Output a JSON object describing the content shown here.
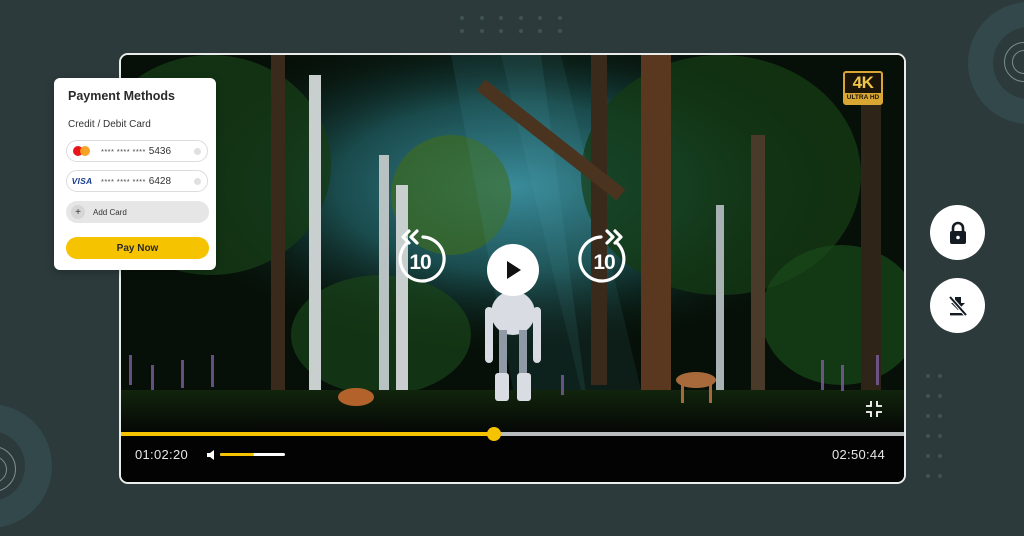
{
  "player": {
    "quality_badge": {
      "main": "4K",
      "sub": "ULTRA HD"
    },
    "skip_back_seconds": "10",
    "skip_forward_seconds": "10",
    "current_time": "01:02:20",
    "total_time": "02:50:44",
    "progress": 0.476,
    "volume": 0.52,
    "icons": {
      "play": "play-icon",
      "skip_back": "rewind-10-icon",
      "skip_forward": "forward-10-icon",
      "volume": "volume-icon",
      "fullscreen": "fullscreen-exit-icon"
    }
  },
  "payment": {
    "title": "Payment Methods",
    "subtitle": "Credit / Debit Card",
    "cards": [
      {
        "brand": "mastercard",
        "mask": "**** **** ****",
        "last4": "5436"
      },
      {
        "brand": "VISA",
        "mask": "**** **** ****",
        "last4": "6428"
      }
    ],
    "add_card_label": "Add Card",
    "add_card_icon": "+",
    "pay_button_label": "Pay Now"
  },
  "side_actions": [
    {
      "name": "lock",
      "icon": "lock-icon"
    },
    {
      "name": "download-off",
      "icon": "download-off-icon"
    }
  ],
  "colors": {
    "background": "#2c3a3c",
    "accent": "#f6c300",
    "player_bg": "#020302"
  }
}
